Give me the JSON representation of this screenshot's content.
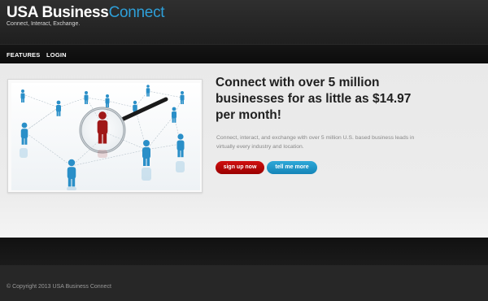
{
  "header": {
    "logo_main": "USA Business",
    "logo_accent": "Connect",
    "tagline": "Connect, Interact, Exchange."
  },
  "nav": {
    "items": [
      {
        "label": "FEATURES"
      },
      {
        "label": "LOGIN"
      }
    ]
  },
  "hero": {
    "headline": "Connect with over 5 million businesses for as little as $14.97 per month!",
    "subtext": "Connect, interact, and exchange with over 5 million U.S. based business leads in virtually every industry and location.",
    "signup_label": "sign up now",
    "more_label": "tell me more",
    "image_icon": "network-magnifier-illustration"
  },
  "footer": {
    "copyright": "© Copyright 2013 USA Business Connect"
  },
  "colors": {
    "accent_blue": "#2e9fd8",
    "signup_red": "#c00000",
    "more_blue": "#1e96c8",
    "figure_blue": "#2a8fc8",
    "figure_red": "#a01818"
  }
}
